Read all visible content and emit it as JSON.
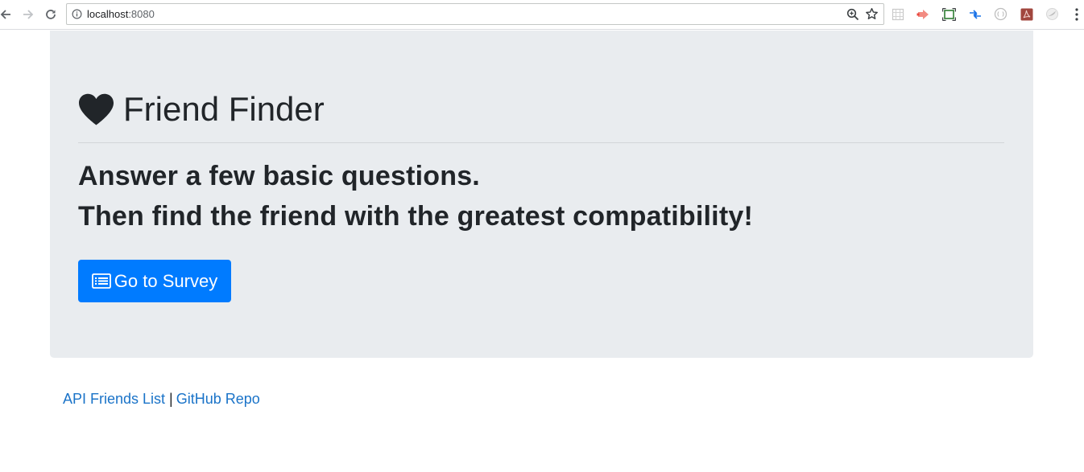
{
  "browser": {
    "url_host": "localhost",
    "url_port": ":8080",
    "icons": {
      "back": "back-arrow-icon",
      "forward": "forward-arrow-icon",
      "reload": "reload-icon",
      "info": "info-icon",
      "zoom": "zoom-icon",
      "bookmark": "star-icon",
      "menu": "more-vertical-icon"
    },
    "extensions": [
      "grid-extension-icon",
      "red-arrow-extension-icon",
      "screen-capture-extension-icon",
      "blue-arrows-extension-icon",
      "circle-extension-icon",
      "pdf-extension-icon",
      "cloud-extension-icon"
    ]
  },
  "page": {
    "title": "Friend Finder",
    "title_icon": "heart-icon",
    "lead_line_1": "Answer a few basic questions.",
    "lead_line_2": "Then find the friend with the greatest compatibility!",
    "survey_button": {
      "label": "Go to Survey",
      "icon": "list-alt-icon",
      "color": "#007bff"
    },
    "jumbotron_bg": "#e9ecef"
  },
  "footer": {
    "link_api": "API Friends List",
    "separator": "|",
    "link_github": "GitHub Repo",
    "link_color": "#1a73c8"
  }
}
